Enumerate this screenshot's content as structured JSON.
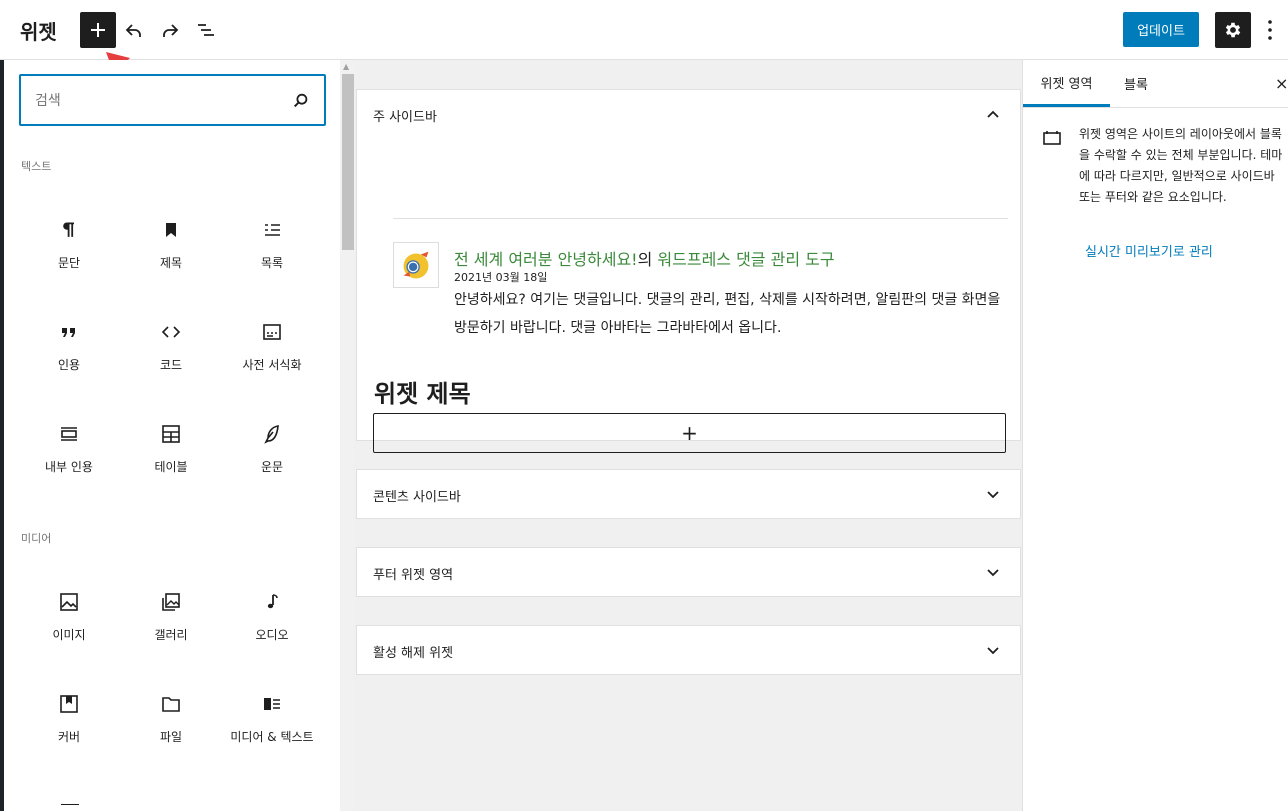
{
  "header": {
    "title": "위젯",
    "update_label": "업데이트"
  },
  "inserter": {
    "search_placeholder": "검색",
    "categories": {
      "text": "텍스트",
      "media": "미디어"
    },
    "text_blocks": [
      {
        "label": "문단",
        "icon": "paragraph-icon"
      },
      {
        "label": "제목",
        "icon": "heading-icon"
      },
      {
        "label": "목록",
        "icon": "list-icon"
      },
      {
        "label": "인용",
        "icon": "quote-icon"
      },
      {
        "label": "코드",
        "icon": "code-icon"
      },
      {
        "label": "사전 서식화",
        "icon": "preformatted-icon"
      },
      {
        "label": "내부 인용",
        "icon": "pullquote-icon"
      },
      {
        "label": "테이블",
        "icon": "table-icon"
      },
      {
        "label": "운문",
        "icon": "verse-icon"
      }
    ],
    "media_blocks": [
      {
        "label": "이미지",
        "icon": "image-icon"
      },
      {
        "label": "갤러리",
        "icon": "gallery-icon"
      },
      {
        "label": "오디오",
        "icon": "audio-icon"
      },
      {
        "label": "커버",
        "icon": "cover-icon"
      },
      {
        "label": "파일",
        "icon": "file-icon"
      },
      {
        "label": "미디어 & 텍스트",
        "icon": "media-text-icon"
      }
    ]
  },
  "canvas": {
    "main_sidebar": {
      "title": "주 사이드바",
      "comment": {
        "link_title": "전 세계 여러분 안녕하세요!",
        "connector": "의 ",
        "link_author": "워드프레스 댓글 관리 도구",
        "date": "2021년 03월 18일",
        "text": "안녕하세요? 여기는 댓글입니다. 댓글의 관리, 편집, 삭제를 시작하려면, 알림판의 댓글 화면을 방문하기 바랍니다. 댓글 아바타는 그라바타에서 옵니다."
      },
      "widget_heading": "위젯 제목",
      "add_block": "+"
    },
    "areas": [
      {
        "title": "콘텐츠 사이드바"
      },
      {
        "title": "푸터 위젯 영역"
      },
      {
        "title": "활성 해제 위젯"
      }
    ]
  },
  "settings_sidebar": {
    "tabs": [
      "위젯 영역",
      "블록"
    ],
    "close": "×",
    "description": "위젯 영역은 사이트의 레이아웃에서 블록을 수락할 수 있는 전체 부분입니다. 테마에 따라 다르지만, 일반적으로 사이드바 또는 푸터와 같은 요소입니다.",
    "live_preview_link": "실시간 미리보기로 관리"
  },
  "colors": {
    "accent": "#007cba",
    "dark": "#1e1e1e",
    "link_green": "#3a8a3a"
  }
}
